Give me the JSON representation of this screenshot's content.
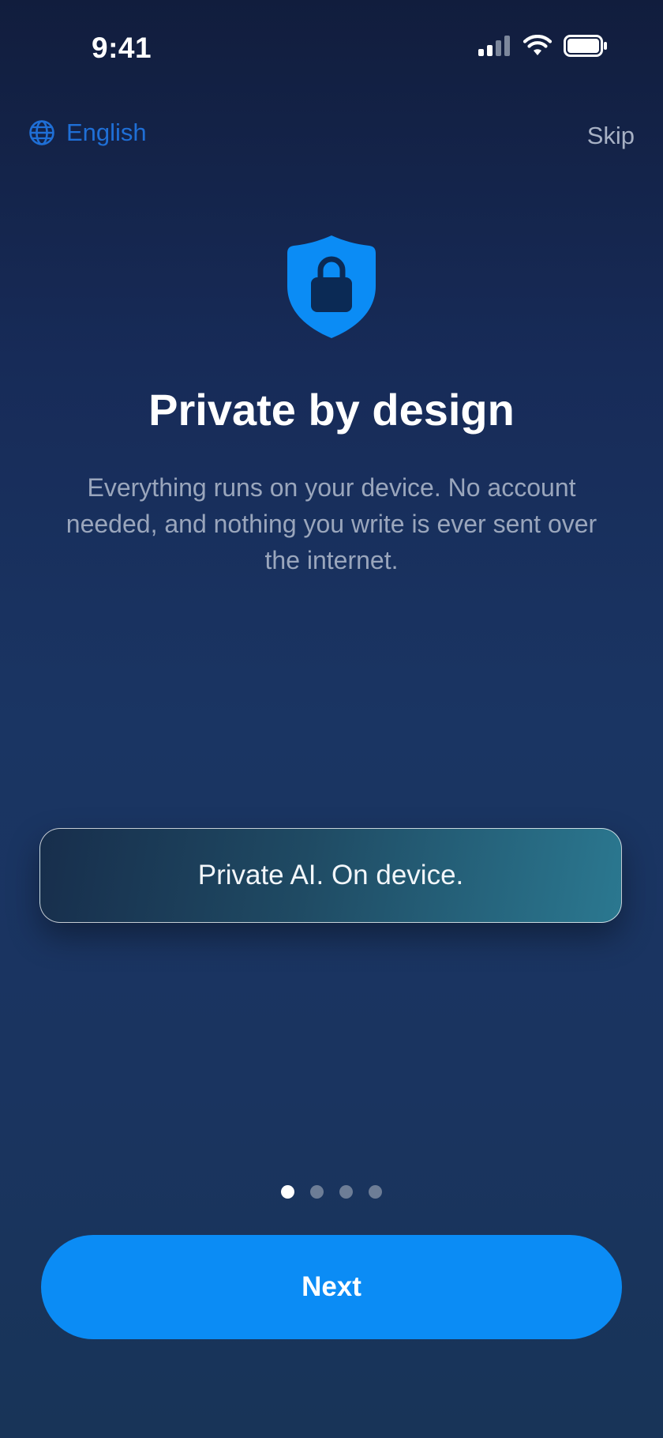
{
  "status_bar": {
    "time": "9:41",
    "icons": [
      "cellular-signal-icon",
      "wifi-icon",
      "battery-icon"
    ]
  },
  "header": {
    "language_label": "English",
    "skip_label": "Skip"
  },
  "hero": {
    "icon": "shield-lock-icon",
    "title": "Private by design",
    "body": "Everything runs on your device. No account needed, and nothing you write is ever sent over the internet."
  },
  "tagline": {
    "text": "Private AI. On device."
  },
  "pagination": {
    "total": 4,
    "current": 1
  },
  "footer": {
    "next_label": "Next"
  },
  "colors": {
    "accent": "#0b8cf5",
    "language_link": "#1f6fd6"
  }
}
